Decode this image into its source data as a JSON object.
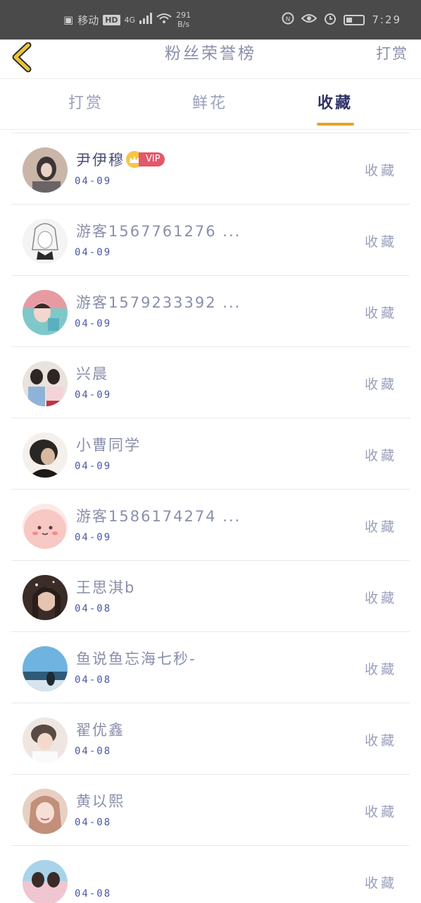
{
  "status_bar": {
    "carrier": "移动",
    "hd": "HD",
    "signal_type": "4G",
    "net_speed_value": "291",
    "net_speed_unit": "B/s",
    "time": "7:29"
  },
  "nav": {
    "title": "粉丝荣誉榜",
    "right_label": "打赏"
  },
  "tabs": [
    {
      "label": "打赏",
      "active": false
    },
    {
      "label": "鲜花",
      "active": false
    },
    {
      "label": "收藏",
      "active": true
    }
  ],
  "fans": [
    {
      "name": "尹伊穆",
      "date": "04-09",
      "action": "收藏",
      "vip": "VIP",
      "avatar_colors": [
        "#c9b6a8",
        "#3d3436"
      ]
    },
    {
      "name": "游客1567761276 ...",
      "date": "04-09",
      "action": "收藏",
      "avatar_colors": [
        "#f4f4f4",
        "#2a2a2a"
      ]
    },
    {
      "name": "游客1579233392 ...",
      "date": "04-09",
      "action": "收藏",
      "avatar_colors": [
        "#e89aa2",
        "#7fc8c9"
      ]
    },
    {
      "name": "兴晨",
      "date": "04-09",
      "action": "收藏",
      "avatar_colors": [
        "#e9e2dd",
        "#8fb3d8"
      ]
    },
    {
      "name": "小曹同学",
      "date": "04-09",
      "action": "收藏",
      "avatar_colors": [
        "#2a2624",
        "#d6b9a3"
      ]
    },
    {
      "name": "游客1586174274 ...",
      "date": "04-09",
      "action": "收藏",
      "avatar_colors": [
        "#f7c8c4",
        "#f4a6a0"
      ]
    },
    {
      "name": "王思淇b",
      "date": "04-08",
      "action": "收藏",
      "avatar_colors": [
        "#3a2c28",
        "#c7a08a"
      ]
    },
    {
      "name": "鱼说鱼忘海七秒-",
      "date": "04-08",
      "action": "收藏",
      "avatar_colors": [
        "#6fb3e0",
        "#2f5b7a"
      ]
    },
    {
      "name": "翟优鑫",
      "date": "04-08",
      "action": "收藏",
      "avatar_colors": [
        "#efe6e2",
        "#5a4a44"
      ]
    },
    {
      "name": "黄以熙",
      "date": "04-08",
      "action": "收藏",
      "avatar_colors": [
        "#e8cfc4",
        "#c28f7a"
      ]
    },
    {
      "name": "",
      "date": "04-08",
      "action": "收藏",
      "avatar_colors": [
        "#a9d3ea",
        "#f0c6d0"
      ]
    }
  ],
  "colors": {
    "accent_underline": "#f0a020",
    "active_tab": "#2e3266",
    "muted_text": "#8a8fab",
    "date_text": "#4a58a0",
    "vip_badge": "#e2586a",
    "crown": "#f6c544",
    "back_arrow": "#e8c43c"
  },
  "icons": {
    "back": "chevron-left-icon",
    "crown": "crown-icon",
    "wifi": "wifi-icon",
    "alarm": "alarm-icon",
    "eye": "eye-icon"
  }
}
